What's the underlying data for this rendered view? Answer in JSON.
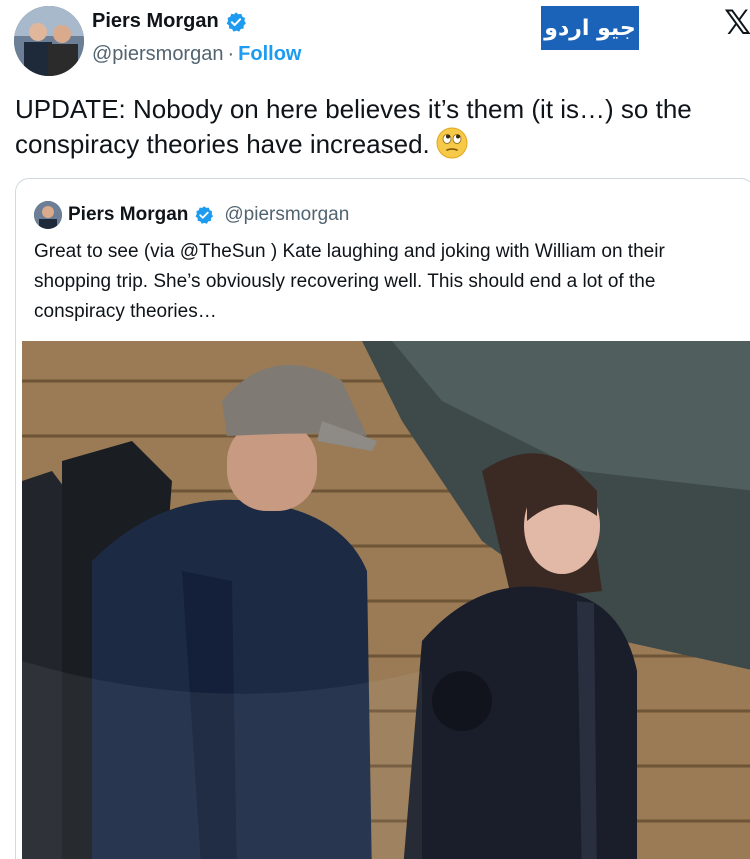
{
  "author": {
    "name": "Piers Morgan",
    "handle": "@piersmorgan",
    "separator": "·",
    "follow_label": "Follow",
    "verified_icon": "verified-badge-icon"
  },
  "badge": {
    "label": "جیو اردو",
    "color": "#1a63b8"
  },
  "brand_icon": {
    "glyph": "𝕏",
    "name": "x-logo-icon"
  },
  "post": {
    "text": "UPDATE: Nobody on here believes it’s them (it is…) so the conspiracy theories have increased.",
    "emoji": "face-with-rolling-eyes-icon"
  },
  "quoted_post": {
    "name": "Piers Morgan",
    "handle": "@piersmorgan",
    "text": "Great to see (via @TheSun ) Kate laughing and joking with William on their shopping trip. She’s obviously recovering well. This should end a lot of the conspiracy theories…",
    "media": "photo-couple-walking"
  },
  "colors": {
    "link": "#1d9bf0",
    "secondary": "#536471",
    "border": "#cfd9de"
  }
}
